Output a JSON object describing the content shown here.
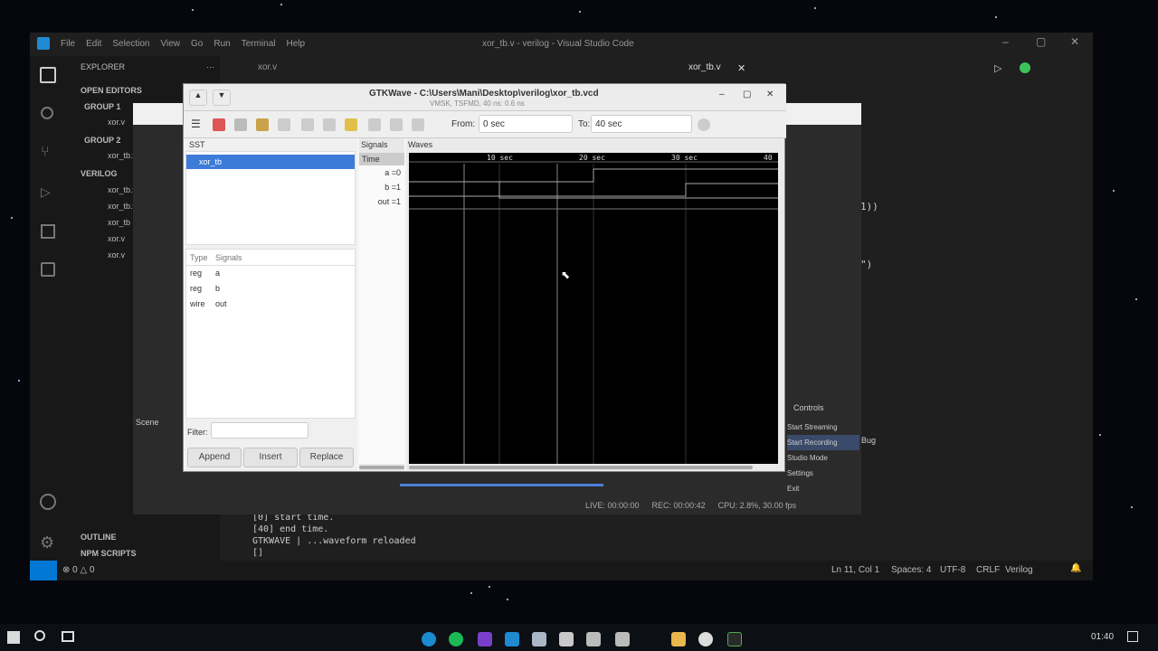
{
  "vscode": {
    "title": "xor_tb.v - verilog - Visual Studio Code",
    "menu": [
      "File",
      "Edit",
      "Selection",
      "View",
      "Go",
      "Run",
      "Terminal",
      "Help"
    ],
    "tabs": [
      {
        "label": "xor.v"
      },
      {
        "label": "xor_tb.v"
      }
    ],
    "sidebar": {
      "explorer_title": "EXPLORER",
      "open_editors": "OPEN EDITORS",
      "group1": "GROUP 1",
      "group1_file": "xor.v",
      "group2": "GROUP 2",
      "group2_file": "xor_tb.v",
      "project": "VERILOG",
      "files": [
        "xor_tb.vcd",
        "xor_tb.v",
        "xor_tb",
        "xor.v",
        "xor.v"
      ],
      "outline": "OUTLINE",
      "npm": "NPM SCRIPTS"
    },
    "editor_snippets": [
      "1))",
      "\")"
    ],
    "terminal_lines": [
      "[0] start time.",
      "[40] end time.",
      "GTKWAVE | ...waveform reloaded",
      "[]"
    ],
    "status": {
      "left": "⊗ 0 △ 0",
      "position": "Ln 11, Col 1",
      "spaces": "Spaces: 4",
      "encoding": "UTF-8",
      "eol": "CRLF",
      "language": "Verilog"
    }
  },
  "obs": {
    "scene_label": "Scene",
    "controls": [
      "Start Streaming",
      "Start Recording",
      "Studio Mode",
      "Settings",
      "Exit"
    ],
    "controls_header": "Controls",
    "stats": [
      "CPU: 2.8%, 30.00 fps",
      "REC: 00:00:42",
      "LIVE: 00:00:00"
    ],
    "log_label": "Bug"
  },
  "gtkwave": {
    "title": "GTKWave - C:\\Users\\Mani\\Desktop\\verilog\\xor_tb.vcd",
    "subtitle": "VMSK, TSFMD, 40 ns: 0.6 ns",
    "from_label": "From:",
    "from_value": "0 sec",
    "to_label": "To:",
    "to_value": "40 sec",
    "sst_header": "SST",
    "tree_item": "xor_tb",
    "type_header": "Type",
    "signals_header_col": "Signals",
    "vars": [
      {
        "type": "reg",
        "name": "a"
      },
      {
        "type": "reg",
        "name": "b"
      },
      {
        "type": "wire",
        "name": "out"
      }
    ],
    "filter_label": "Filter:",
    "buttons": [
      "Append",
      "Insert",
      "Replace"
    ],
    "signals_header": "Signals",
    "time_label": "Time",
    "signal_names": [
      "a =0",
      "b =1",
      "out =1"
    ],
    "waves_header": "Waves",
    "ruler": [
      "10 sec",
      "20 sec",
      "30 sec",
      "40"
    ]
  },
  "taskbar": {
    "time": "01:40"
  }
}
